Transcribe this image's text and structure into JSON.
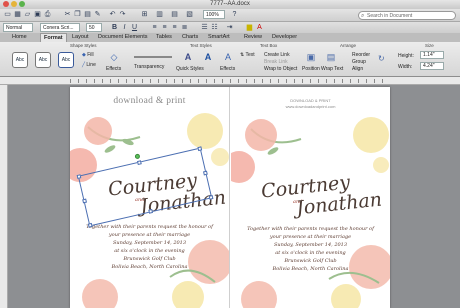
{
  "window": {
    "title": "7777--AA.docx"
  },
  "toolbar": {
    "zoom": "100%",
    "search_placeholder": "Search in Document"
  },
  "format_bar": {
    "style": "Normal",
    "font": "Conera Scri...",
    "size": "50"
  },
  "ribbon_tabs": [
    "Home",
    "Format",
    "Layout",
    "Document Elements",
    "Tables",
    "Charts",
    "SmartArt",
    "Review",
    "Developer"
  ],
  "ribbon": {
    "groups": {
      "shape_styles": "Shape Styles",
      "text_styles": "Text Styles",
      "text_box": "Text Box",
      "arrange": "Arrange",
      "size": "Size"
    },
    "shape_style_samples": [
      "Abc",
      "Abc",
      "Abc"
    ],
    "fill": "Fill",
    "line": "Line",
    "effects": "Effects",
    "transparency": "Transparency",
    "quick_styles": "Quick Styles",
    "text_effects": "Effects",
    "text_direction": "Text",
    "create_link": "Create Link",
    "break_link": "Break Link",
    "wrap_to_object": "Wrap to Object",
    "position": "Position",
    "wrap_text": "Wrap Text",
    "reorder": "Reorder",
    "group": "Group",
    "align": "Align",
    "height_label": "Height:",
    "height_value": "1.14\"",
    "width_label": "Width:",
    "width_value": "4.24\""
  },
  "document": {
    "brand": "download & print",
    "brand_line1": "DOWNLOAD & PRINT",
    "brand_line2": "www.downloadandprint.com",
    "name1": "Courtney",
    "and": "and",
    "name2": "Jonathan",
    "invite_lines": [
      "Together with their parents request the honour of",
      "your presence at their marriage",
      "Sunday, September 14, 2013",
      "at six o'clock in the evening",
      "Brunswick Golf Club",
      "Bolivia Beach, North Carolina"
    ]
  },
  "colors": {
    "flower_pink": "#f3b6a8",
    "flower_yellow": "#f6e6a6",
    "leaf_green": "#9dbf8f",
    "selection": "#4c6fb2"
  }
}
